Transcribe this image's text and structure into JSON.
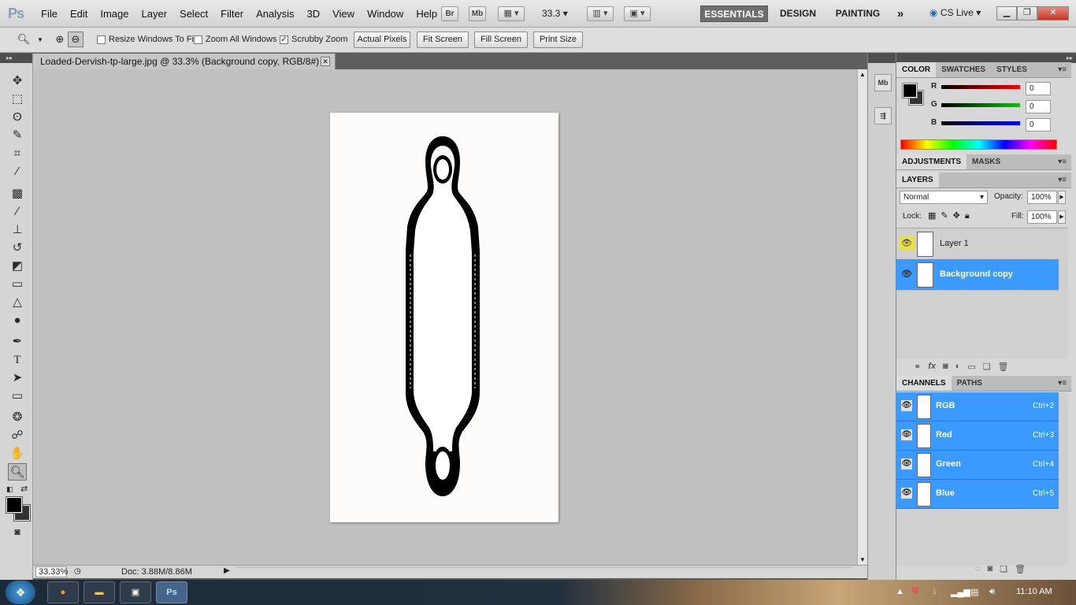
{
  "app": {
    "logo": "Ps",
    "menus": [
      "File",
      "Edit",
      "Image",
      "Layer",
      "Select",
      "Filter",
      "Analysis",
      "3D",
      "View",
      "Window",
      "Help"
    ],
    "bridge_label": "Br",
    "minibridge_label": "Mb",
    "zoom_value": "33.3",
    "workspaces": [
      "ESSENTIALS",
      "DESIGN",
      "PAINTING"
    ],
    "active_workspace": "ESSENTIALS",
    "more_label": "»",
    "cs_live": "CS Live"
  },
  "options": {
    "resize_windows": "Resize Windows To Fit",
    "zoom_all": "Zoom All Windows",
    "scrubby_zoom": "Scrubby Zoom",
    "actual_pixels": "Actual Pixels",
    "fit_screen": "Fit Screen",
    "fill_screen": "Fill Screen",
    "print_size": "Print Size"
  },
  "document": {
    "tab_title": "Loaded-Dervish-tp-large.jpg @ 33.3% (Background copy, RGB/8#) *",
    "status_zoom": "33.33%",
    "status_doc": "Doc: 3.88M/8.86M"
  },
  "color_panel": {
    "tabs": [
      "COLOR",
      "SWATCHES",
      "STYLES"
    ],
    "r_label": "R",
    "g_label": "G",
    "b_label": "B",
    "r": "0",
    "g": "0",
    "b": "0"
  },
  "adjustments": {
    "tabs": [
      "ADJUSTMENTS",
      "MASKS"
    ]
  },
  "layers_panel": {
    "tab": "LAYERS",
    "blend_mode": "Normal",
    "opacity_label": "Opacity:",
    "opacity": "100%",
    "lock_label": "Lock:",
    "fill_label": "Fill:",
    "fill": "100%",
    "layers": [
      {
        "name": "Layer 1",
        "selected": false
      },
      {
        "name": "Background copy",
        "selected": true
      }
    ]
  },
  "channels_panel": {
    "tabs": [
      "CHANNELS",
      "PATHS"
    ],
    "channels": [
      {
        "name": "RGB",
        "key": "Ctrl+2"
      },
      {
        "name": "Red",
        "key": "Ctrl+3"
      },
      {
        "name": "Green",
        "key": "Ctrl+4"
      },
      {
        "name": "Blue",
        "key": "Ctrl+5"
      }
    ]
  },
  "taskbar": {
    "time": "11:10 AM"
  }
}
